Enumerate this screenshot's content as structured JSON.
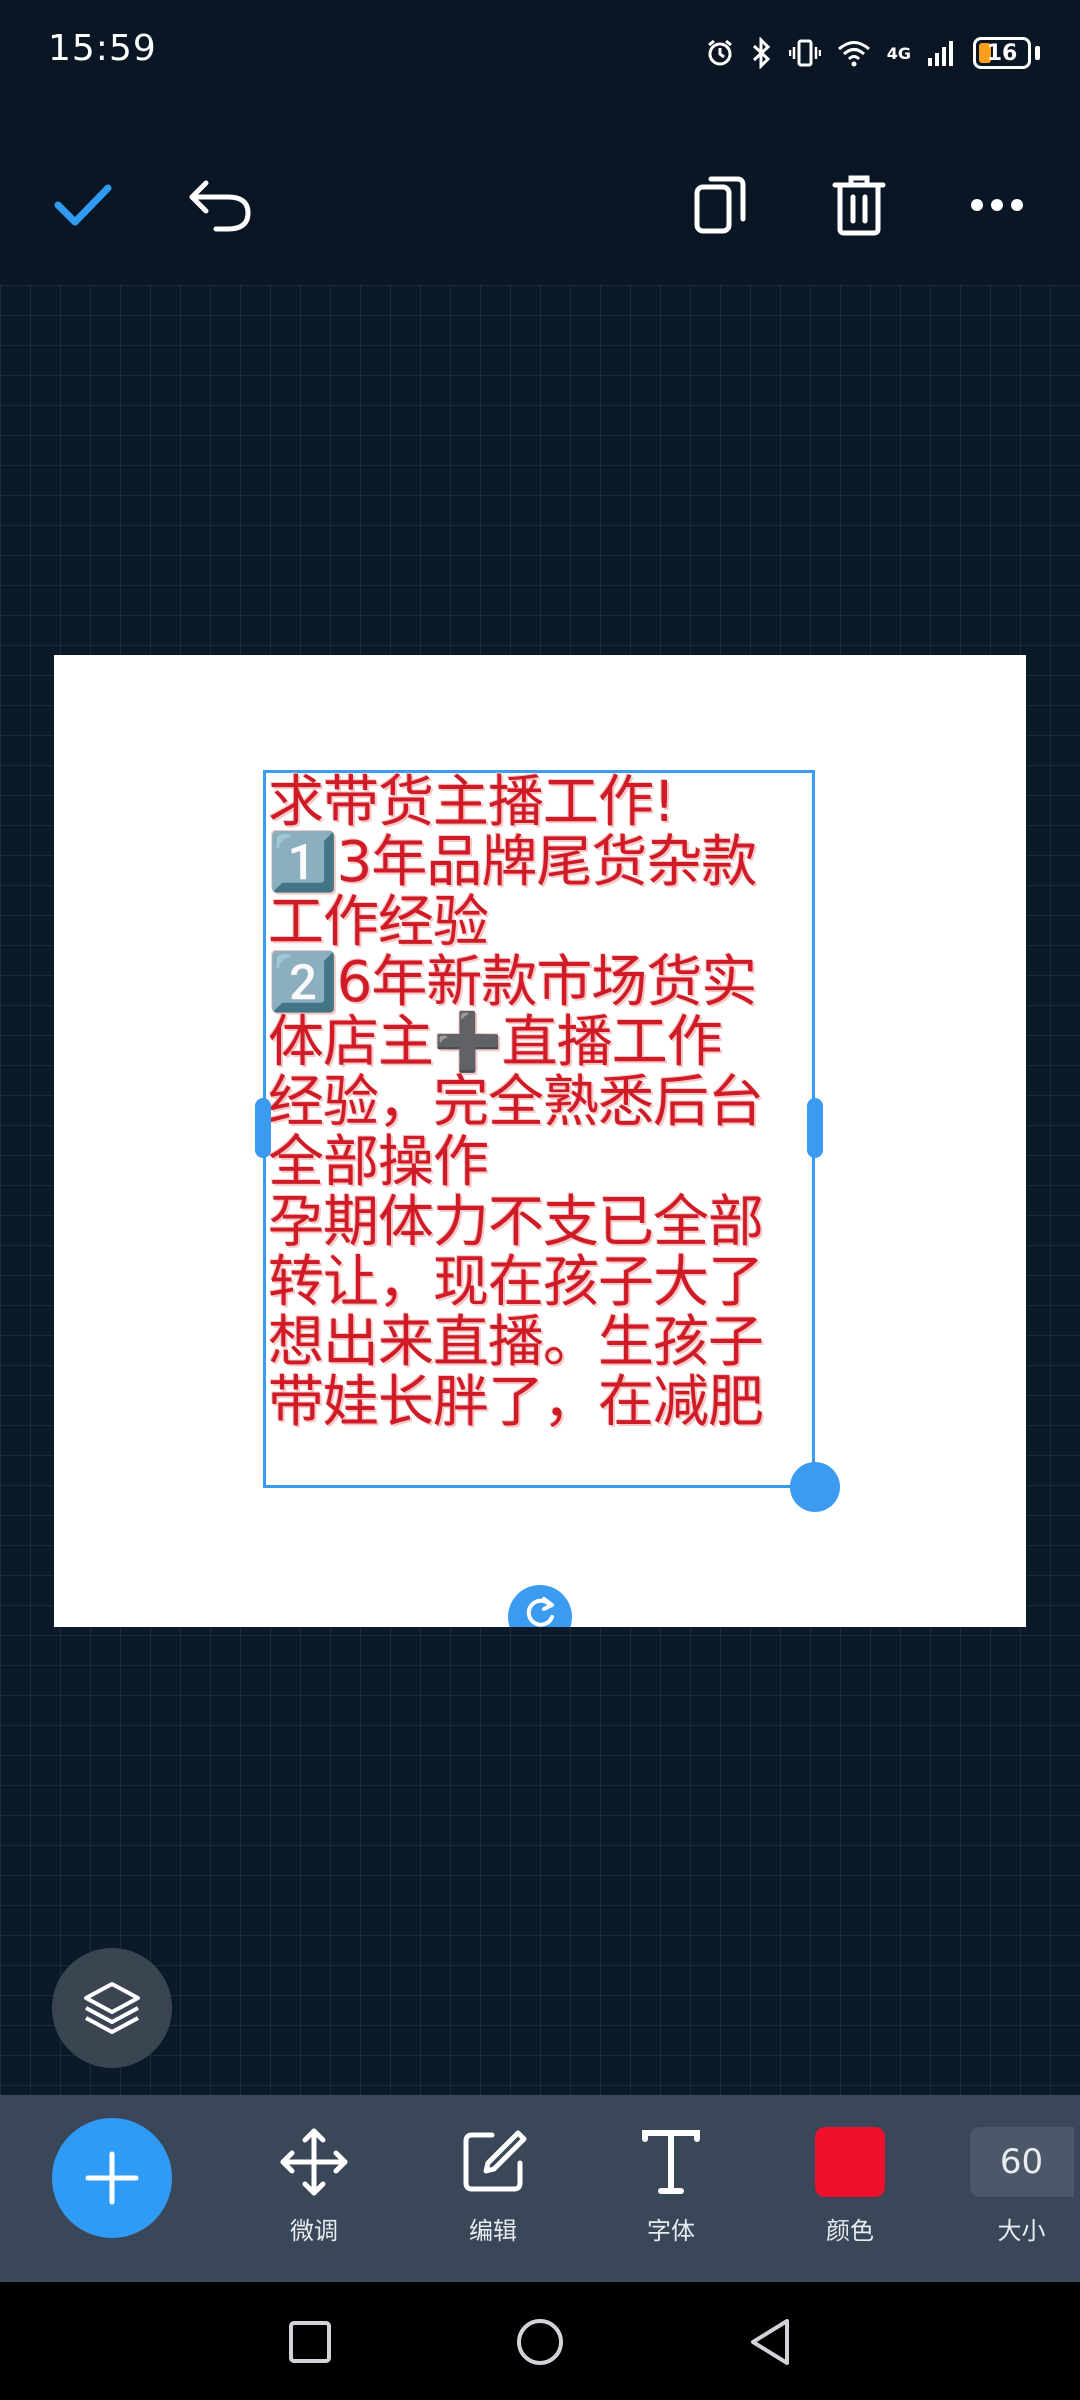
{
  "status_bar": {
    "time": "15:59",
    "network": "4G",
    "battery": "16",
    "icons": [
      "alarm-icon",
      "bluetooth-icon",
      "vibrate-icon",
      "wifi-icon",
      "signal-icon",
      "battery-icon"
    ]
  },
  "toolbar": {
    "confirm_icon": "check-icon",
    "undo_icon": "undo-icon",
    "copy_icon": "copy-icon",
    "delete_icon": "trash-icon",
    "more_icon": "more-icon"
  },
  "canvas": {
    "text_lines": [
      "求带货主播工作!",
      "1️⃣3年品牌尾货杂款",
      "工作经验",
      "2️⃣6年新款市场货实",
      "体店主➕直播工作",
      "经验，完全熟悉后台",
      "全部操作",
      "孕期体力不支已全部",
      "转让，现在孩子大了",
      "想出来直播。生孩子",
      "带娃长胖了，在减肥"
    ],
    "text_color": "#d01b27"
  },
  "bottom_toolbar": {
    "tools": [
      {
        "label": "微调",
        "icon": "move-icon"
      },
      {
        "label": "编辑",
        "icon": "edit-icon"
      },
      {
        "label": "字体",
        "icon": "font-icon"
      },
      {
        "label": "颜色",
        "icon": "color-swatch"
      },
      {
        "label": "大小",
        "icon": "size-box"
      }
    ],
    "color_value": "#f0102d",
    "size_value": "60"
  },
  "colors": {
    "accent": "#2f9bf5",
    "workspace_bg": "#0b1a29",
    "toolbar_bg": "#3a4758"
  }
}
